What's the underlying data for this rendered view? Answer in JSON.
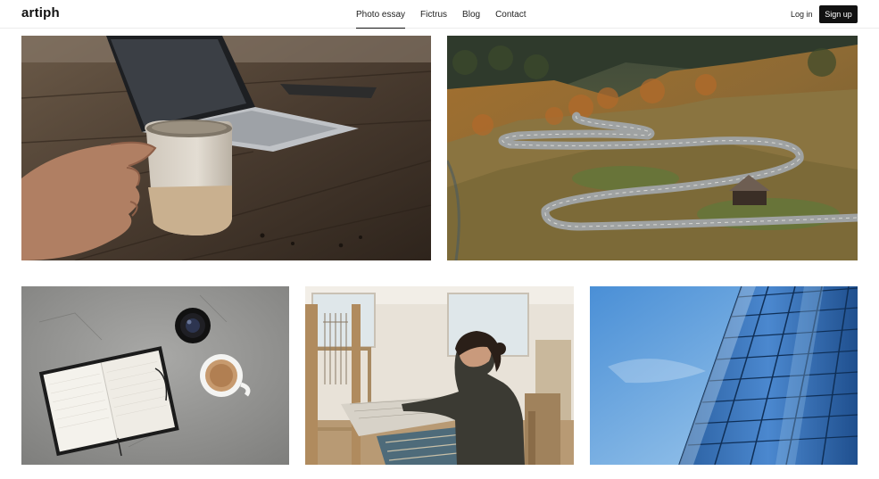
{
  "brand": {
    "name": "artiph"
  },
  "nav": {
    "items": [
      {
        "label": "Photo essay",
        "active": true
      },
      {
        "label": "Fictrus",
        "active": false
      },
      {
        "label": "Blog",
        "active": false
      },
      {
        "label": "Contact",
        "active": false
      }
    ]
  },
  "auth": {
    "login_label": "Log in",
    "signup_label": "Sign up"
  },
  "gallery": {
    "photos": [
      {
        "subject": "hand holding ceramic mug beside laptop on wooden desk"
      },
      {
        "subject": "winding mountain road through autumn alpine valley with hut"
      },
      {
        "subject": "open notebook, camera lens and coffee cup on concrete"
      },
      {
        "subject": "woman weaving at a wooden loom"
      },
      {
        "subject": "glass office building facade against blue sky"
      }
    ]
  },
  "colors": {
    "accent": "#111111",
    "background": "#ffffff",
    "divider": "#ececec"
  }
}
